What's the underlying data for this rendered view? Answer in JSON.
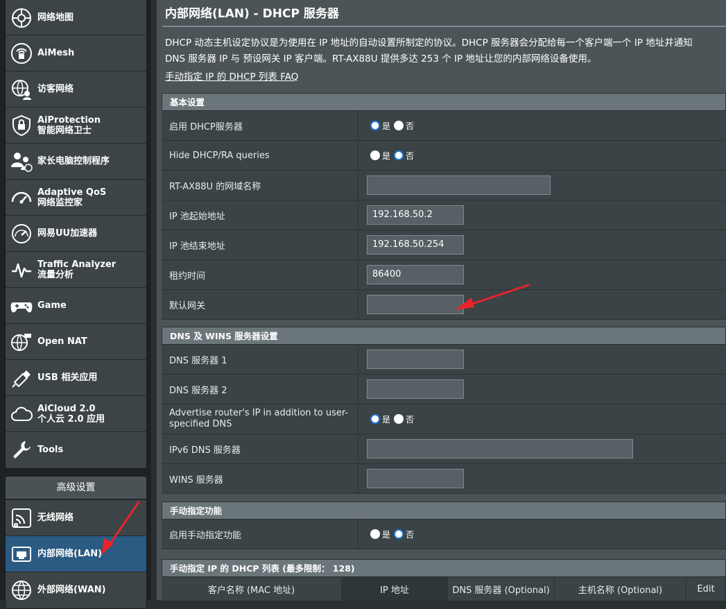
{
  "sidebar": {
    "general": [
      {
        "label1": "网络地图",
        "label2": "",
        "icon": "network-map-icon"
      },
      {
        "label1": "AiMesh",
        "label2": "",
        "icon": "aimesh-icon"
      },
      {
        "label1": "访客网络",
        "label2": "",
        "icon": "guest-network-icon"
      },
      {
        "label1": "AiProtection",
        "label2": "智能网络卫士",
        "icon": "shield-lock-icon"
      },
      {
        "label1": "家长电脑控制程序",
        "label2": "",
        "icon": "parental-control-icon"
      },
      {
        "label1": "Adaptive QoS",
        "label2": "网络监控家",
        "icon": "gauge-icon"
      },
      {
        "label1": "网易UU加速器",
        "label2": "",
        "icon": "speedometer-icon"
      },
      {
        "label1": "Traffic Analyzer",
        "label2": "流量分析",
        "icon": "traffic-analyzer-icon"
      },
      {
        "label1": "Game",
        "label2": "",
        "icon": "gamepad-icon"
      },
      {
        "label1": "Open NAT",
        "label2": "",
        "icon": "open-nat-icon"
      },
      {
        "label1": "USB 相关应用",
        "label2": "",
        "icon": "usb-icon"
      },
      {
        "label1": "AiCloud 2.0",
        "label2": "个人云 2.0 应用",
        "icon": "cloud-icon"
      },
      {
        "label1": "Tools",
        "label2": "",
        "icon": "wrench-icon"
      }
    ],
    "advanced_header": "高级设置",
    "advanced": [
      {
        "label1": "无线网络",
        "label2": "",
        "icon": "wireless-icon"
      },
      {
        "label1": "内部网络(LAN)",
        "label2": "",
        "icon": "lan-icon"
      },
      {
        "label1": "外部网络(WAN)",
        "label2": "",
        "icon": "globe-icon"
      }
    ]
  },
  "page": {
    "title": "内部网络(LAN) - DHCP 服务器",
    "desc_line1": "DHCP 动态主机设定协议是为使用在 IP 地址的自动设置所制定的协议。DHCP 服务器会分配给每一个客户端一个 IP 地址并通知",
    "desc_line2": "DNS 服务器 IP 与 预设网关 IP 客户端。RT-AX88U 提供多达 253 个 IP 地址让您的内部网络设备使用。",
    "faq_link": "手动指定 IP 的 DHCP 列表 FAQ"
  },
  "radio": {
    "yes": "是",
    "no": "否"
  },
  "basic": {
    "header": "基本设置",
    "enable_dhcp": "启用 DHCP服务器",
    "hide_dhcp": "Hide DHCP/RA queries",
    "domain_name": "RT-AX88U 的网域名称",
    "domain_value": "",
    "ip_start": "IP 池起始地址",
    "ip_start_value": "192.168.50.2",
    "ip_end": "IP 池结束地址",
    "ip_end_value": "192.168.50.254",
    "lease": "租约时间",
    "lease_value": "86400",
    "gateway": "默认网关",
    "gateway_value": ""
  },
  "dns": {
    "header": "DNS 及 WINS 服务器设置",
    "dns1": "DNS 服务器 1",
    "dns1_value": "",
    "dns2": "DNS 服务器 2",
    "dns2_value": "",
    "advertise": "Advertise router's IP in addition to user-specified DNS",
    "ipv6_dns": "IPv6 DNS 服务器",
    "ipv6_dns_value": "",
    "wins": "WINS 服务器",
    "wins_value": ""
  },
  "manual": {
    "header": "手动指定功能",
    "enable": "启用手动指定功能"
  },
  "list": {
    "header": "手动指定 IP 的 DHCP 列表 (最多限制： 128)",
    "columns": [
      "客户名称 (MAC 地址)",
      "IP 地址",
      "DNS 服务器 (Optional)",
      "主机名称 (Optional)",
      "Edit"
    ]
  },
  "colors": {
    "accent": "#2b5a82",
    "radio_on": "#1f7fe0",
    "arrow": "#e8242a"
  }
}
